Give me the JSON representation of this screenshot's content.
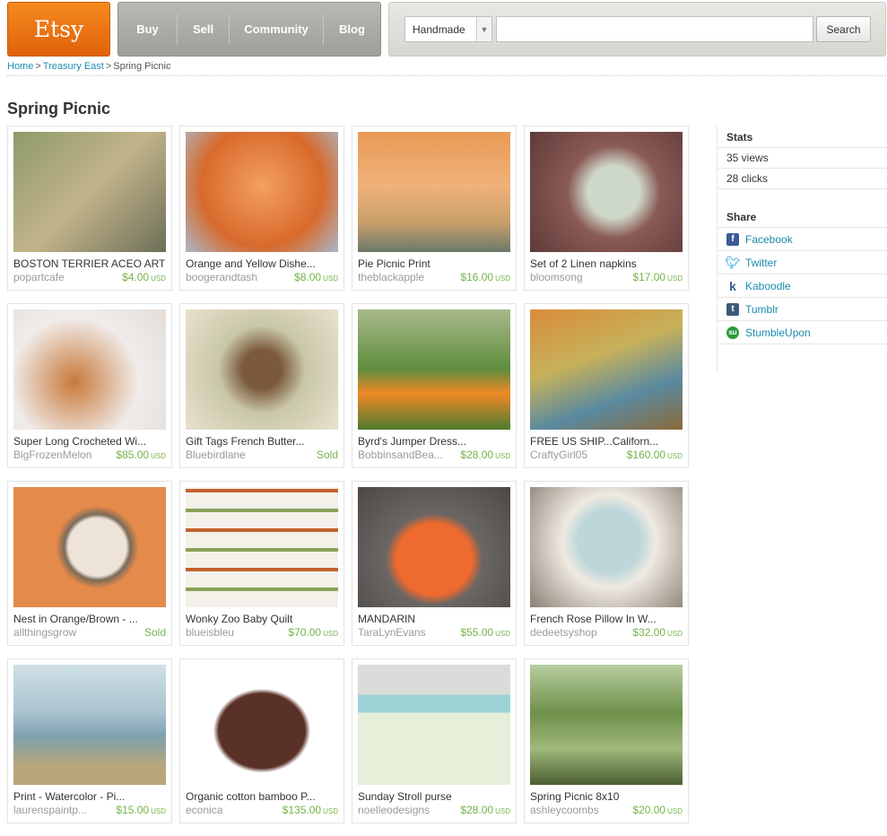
{
  "header": {
    "logo_text": "Etsy",
    "nav": [
      "Buy",
      "Sell",
      "Community",
      "Blog"
    ],
    "search": {
      "category": "Handmade",
      "query": "",
      "button_label": "Search"
    }
  },
  "breadcrumb": {
    "home": "Home",
    "sep1": ">",
    "treasury": "Treasury East",
    "sep2": ">",
    "current": "Spring Picnic"
  },
  "page_title": "Spring Picnic",
  "currency_label": "USD",
  "items": [
    {
      "title": "BOSTON TERRIER ACEO ART",
      "shop": "popartcafe",
      "price": "$4.00"
    },
    {
      "title": "Orange and Yellow Dishe...",
      "shop": "boogerandtash",
      "price": "$8.00"
    },
    {
      "title": "Pie Picnic Print",
      "shop": "theblackapple",
      "price": "$16.00"
    },
    {
      "title": "Set of 2 Linen napkins",
      "shop": "bloomsong",
      "price": "$17.00"
    },
    {
      "title": "Super Long Crocheted Wi...",
      "shop": "BigFrozenMelon",
      "price": "$85.00"
    },
    {
      "title": "Gift Tags French Butter...",
      "shop": "Bluebirdlane",
      "price": "Sold"
    },
    {
      "title": "Byrd's Jumper Dress...",
      "shop": "BobbinsandBea...",
      "price": "$28.00"
    },
    {
      "title": "FREE US SHIP...Californ...",
      "shop": "CraftyGirl05",
      "price": "$160.00"
    },
    {
      "title": "Nest in Orange/Brown - ...",
      "shop": "allthingsgrow",
      "price": "Sold"
    },
    {
      "title": "Wonky Zoo Baby Quilt",
      "shop": "blueisbleu",
      "price": "$70.00"
    },
    {
      "title": "MANDARIN",
      "shop": "TaraLynEvans",
      "price": "$55.00"
    },
    {
      "title": "French Rose Pillow In W...",
      "shop": "dedeetsyshop",
      "price": "$32.00"
    },
    {
      "title": "Print - Watercolor - Pi...",
      "shop": "laurenspaintp...",
      "price": "$15.00"
    },
    {
      "title": "Organic cotton bamboo P...",
      "shop": "econica",
      "price": "$135.00"
    },
    {
      "title": "Sunday Stroll purse",
      "shop": "noelleodesigns",
      "price": "$28.00"
    },
    {
      "title": "Spring Picnic 8x10",
      "shop": "ashleycoombs",
      "price": "$20.00"
    }
  ],
  "sidebar": {
    "stats_heading": "Stats",
    "views": "35 views",
    "clicks": "28 clicks",
    "share_heading": "Share",
    "share": [
      {
        "label": "Facebook",
        "icon": "facebook-icon"
      },
      {
        "label": "Twitter",
        "icon": "twitter-icon"
      },
      {
        "label": "Kaboodle",
        "icon": "kaboodle-icon"
      },
      {
        "label": "Tumblr",
        "icon": "tumblr-icon"
      },
      {
        "label": "StumbleUpon",
        "icon": "stumbleupon-icon"
      }
    ]
  },
  "colors": {
    "brand_orange": "#f1801b",
    "link": "#1c8cae",
    "price": "#73b44a"
  }
}
